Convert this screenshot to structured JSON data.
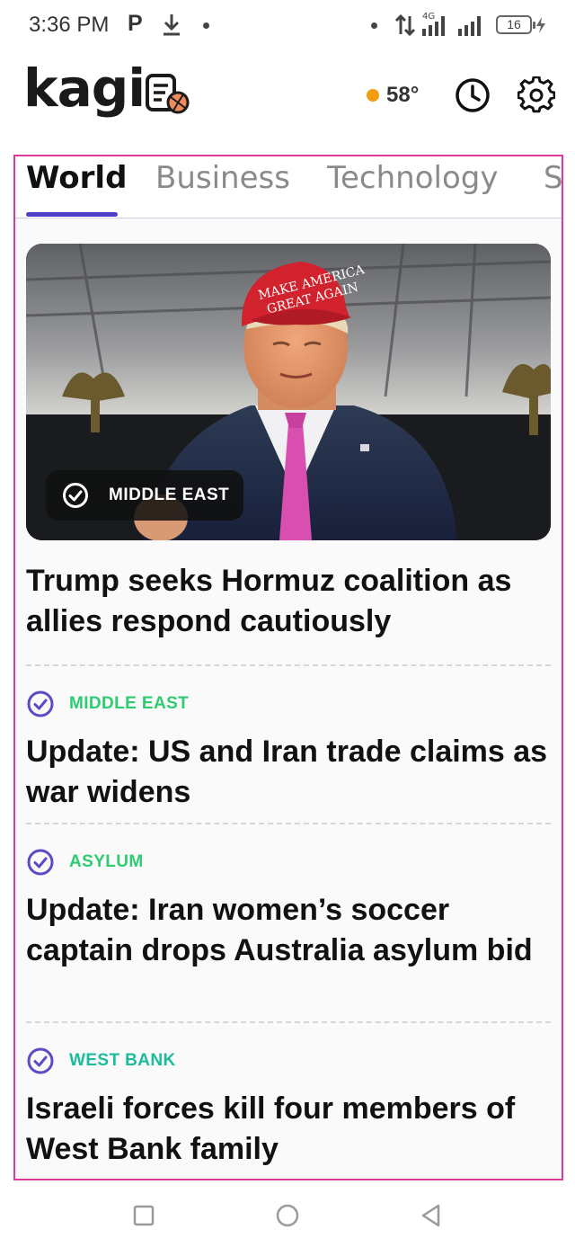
{
  "status_bar": {
    "time": "3:36 PM",
    "p_icon": "P",
    "network_label": "4G",
    "battery": "16"
  },
  "header": {
    "logo": "kagi",
    "weather_temp": "58°",
    "weather_dot_color": "#f39c12",
    "icons": [
      "news-logo-icon",
      "history-clock-icon",
      "settings-gear-icon"
    ]
  },
  "tabs": [
    {
      "label": "World",
      "active": true
    },
    {
      "label": "Business",
      "active": false
    },
    {
      "label": "Technology",
      "active": false
    },
    {
      "label": "Sc",
      "active": false
    }
  ],
  "hero": {
    "category": "MIDDLE EAST",
    "cap_text_1": "MAKE AMERICA",
    "cap_text_2": "GREAT AGAIN",
    "headline": "Trump seeks Hormuz coalition as allies respond cautiously"
  },
  "stories": [
    {
      "category": "MIDDLE EAST",
      "category_color": "#2ecc71",
      "title": "Update: US and Iran trade claims as war widens"
    },
    {
      "category": "ASYLUM",
      "category_color": "#2ecc71",
      "title": "Update: Iran women’s soccer captain drops Australia asylum bid"
    },
    {
      "category": "WEST BANK",
      "category_color": "#1abc9c",
      "title": "Israeli forces kill four members of West Bank family"
    }
  ],
  "colors": {
    "accent": "#4f3fc7",
    "check_icon": "#5b4cc4",
    "frame_highlight": "#e0399e"
  },
  "nav": [
    "recents-square-icon",
    "home-circle-icon",
    "back-triangle-icon"
  ]
}
